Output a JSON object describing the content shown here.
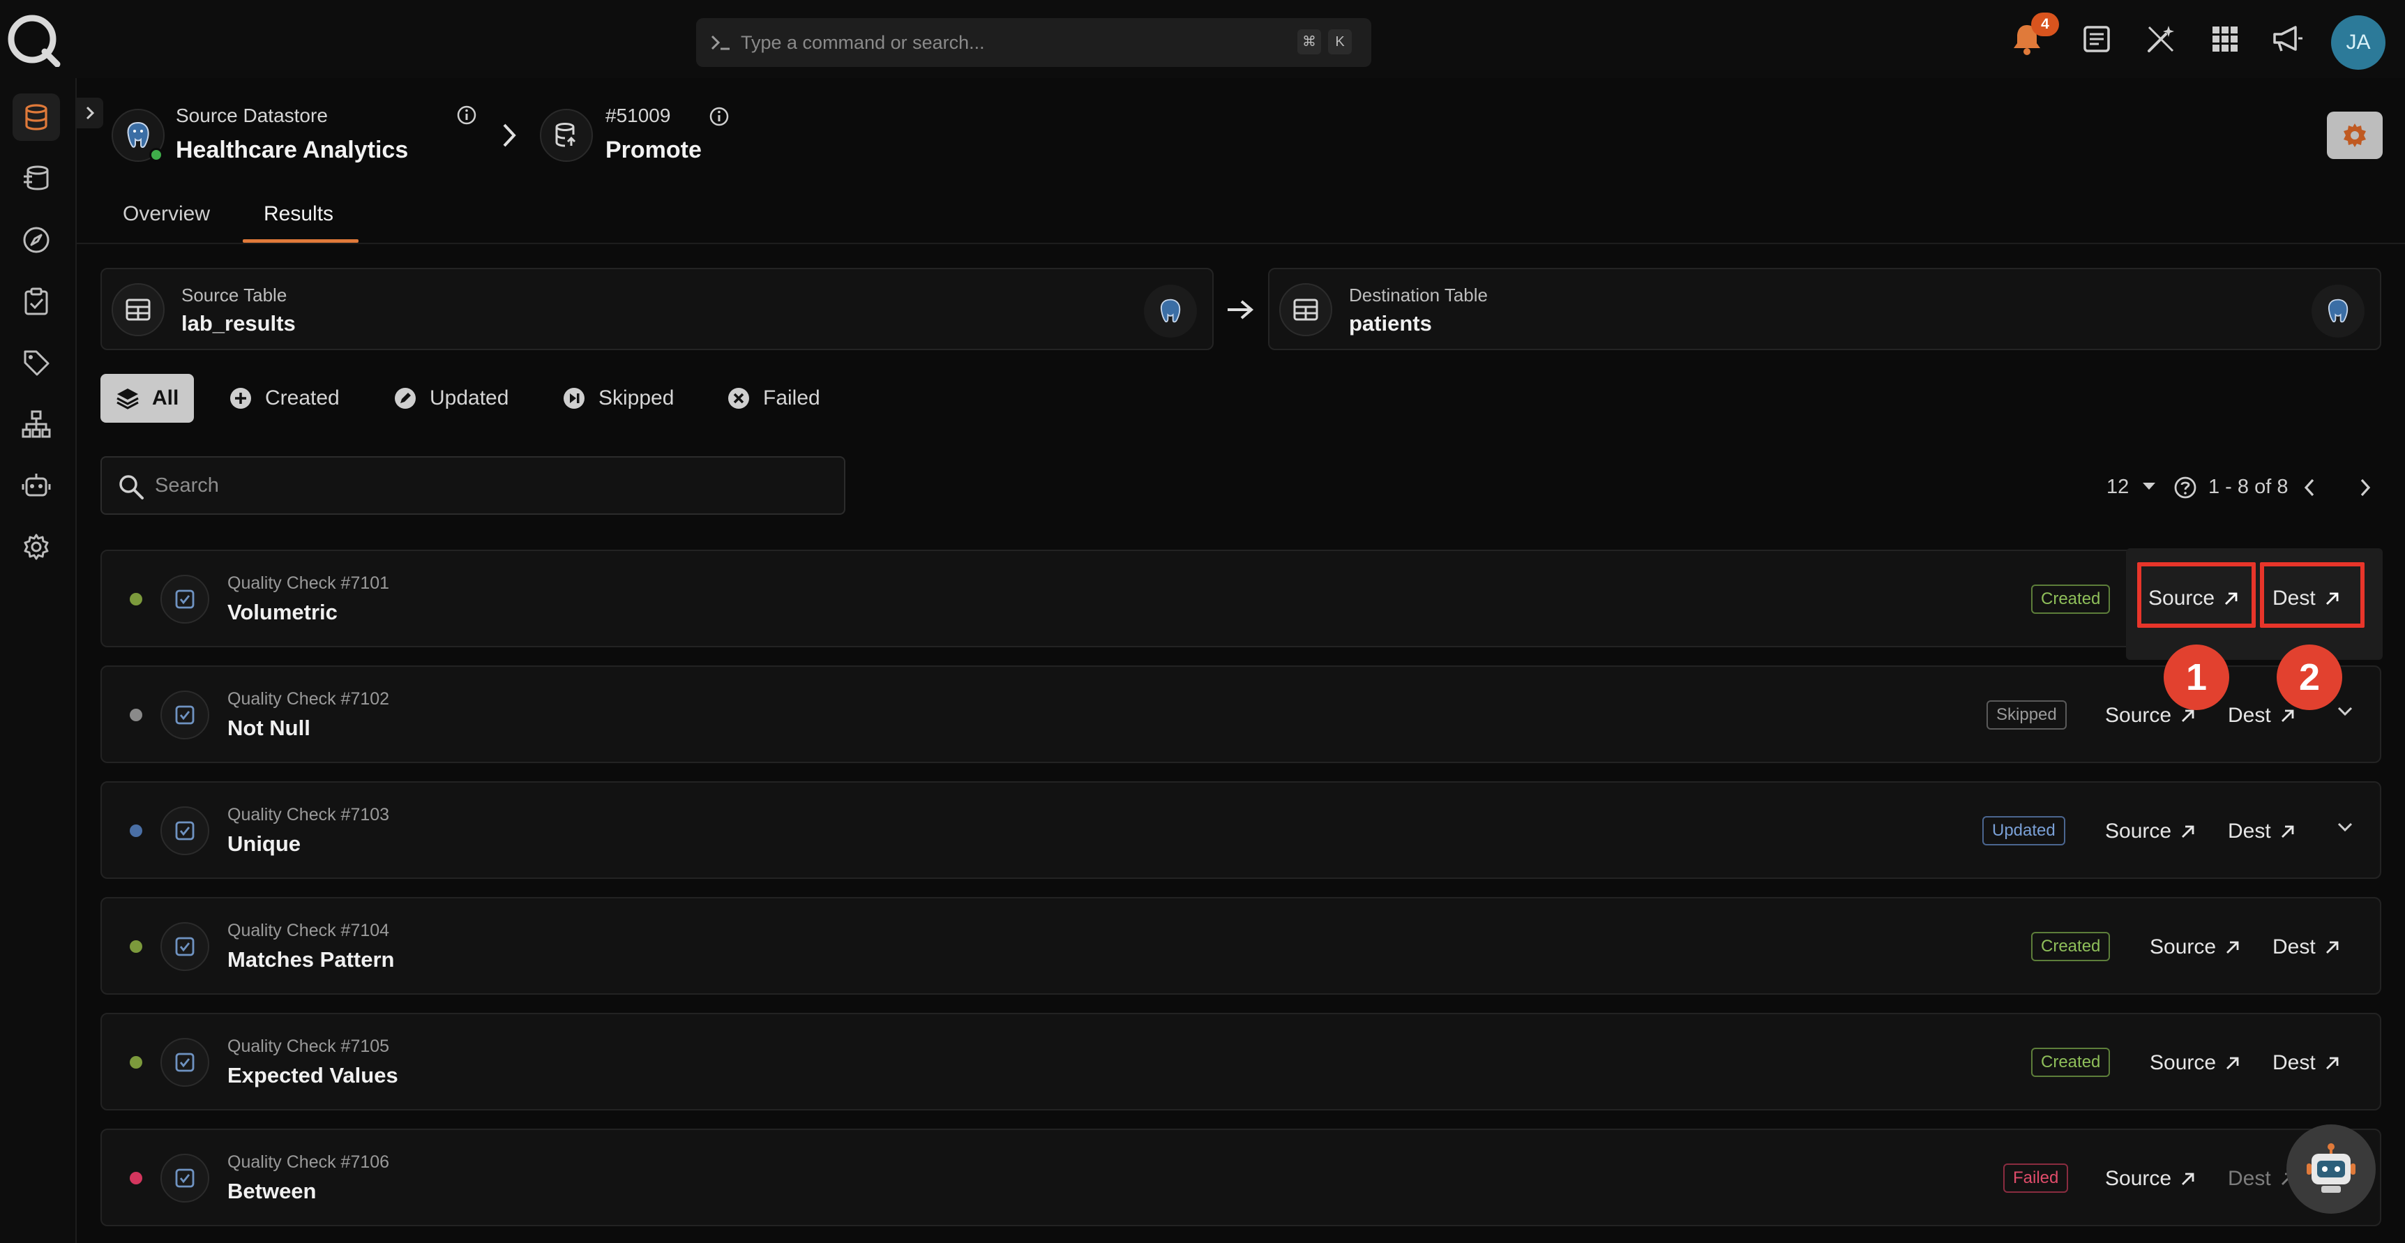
{
  "command_bar": {
    "placeholder": "Type a command or search...",
    "key1": "⌘",
    "key2": "K"
  },
  "notifications": {
    "count": "4"
  },
  "user": {
    "initials": "JA"
  },
  "breadcrumb": {
    "source_label": "Source Datastore",
    "source_name": "Healthcare Analytics",
    "op_id": "#51009",
    "op_name": "Promote"
  },
  "tabs": [
    {
      "label": "Overview"
    },
    {
      "label": "Results"
    }
  ],
  "tables": {
    "source_label": "Source Table",
    "source_name": "lab_results",
    "dest_label": "Destination Table",
    "dest_name": "patients"
  },
  "filters": [
    {
      "label": "All"
    },
    {
      "label": "Created"
    },
    {
      "label": "Updated"
    },
    {
      "label": "Skipped"
    },
    {
      "label": "Failed"
    }
  ],
  "search": {
    "placeholder": "Search"
  },
  "pagination": {
    "per_page": "12",
    "range": "1 - 8 of 8"
  },
  "actions": {
    "source": "Source",
    "dest": "Dest"
  },
  "rows": [
    {
      "label": "Quality Check #7101",
      "name": "Volumetric",
      "status": "Created"
    },
    {
      "label": "Quality Check #7102",
      "name": "Not Null",
      "status": "Skipped"
    },
    {
      "label": "Quality Check #7103",
      "name": "Unique",
      "status": "Updated"
    },
    {
      "label": "Quality Check #7104",
      "name": "Matches Pattern",
      "status": "Created"
    },
    {
      "label": "Quality Check #7105",
      "name": "Expected Values",
      "status": "Created"
    },
    {
      "label": "Quality Check #7106",
      "name": "Between",
      "status": "Failed"
    }
  ],
  "annotations": {
    "marker1": "1",
    "marker2": "2"
  },
  "colors": {
    "accent": "#e07a3a",
    "created": "#8fbf5a",
    "skipped": "#9a9a9a",
    "updated": "#7aa0d6",
    "failed": "#e04c6a",
    "annotation": "#e8352a"
  }
}
